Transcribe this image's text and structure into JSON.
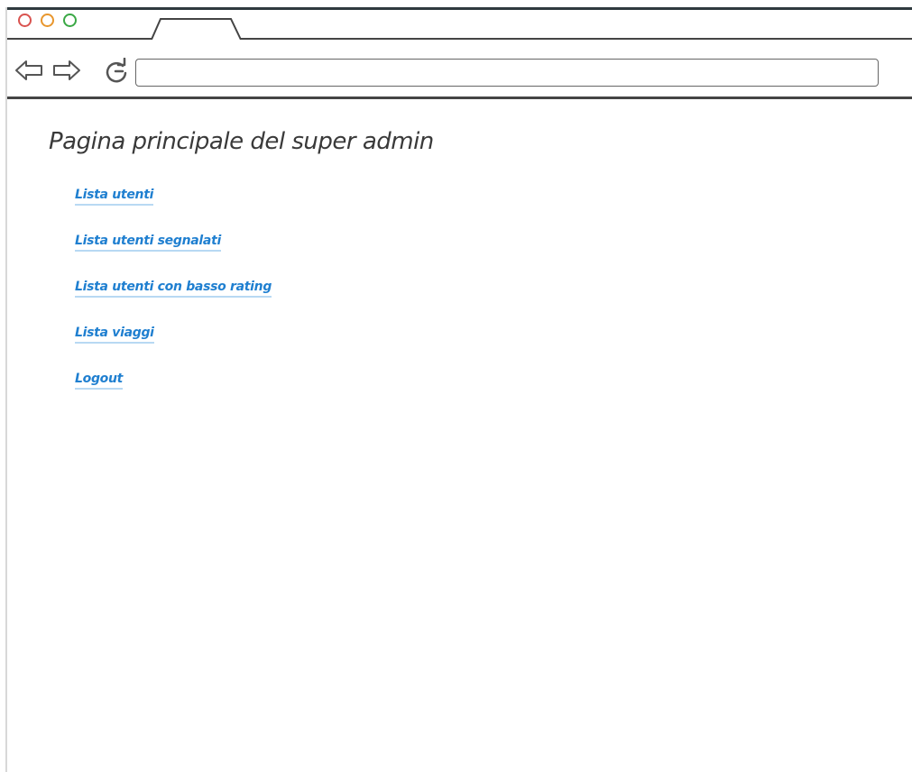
{
  "browser": {
    "tab_title": "",
    "address_value": ""
  },
  "page": {
    "title": "Pagina principale del super admin",
    "links": [
      {
        "label": "Lista utenti"
      },
      {
        "label": "Lista utenti segnalati"
      },
      {
        "label": "Lista utenti con basso rating"
      },
      {
        "label": "Lista viaggi"
      },
      {
        "label": "Logout"
      }
    ]
  },
  "colors": {
    "link": "#1f7fd0",
    "link_underline": "#b8d9f3",
    "title_text": "#3a3a3a",
    "close_button": "#d9534f",
    "minimize_button": "#e8962d",
    "maximize_button": "#3aa845"
  },
  "icons": {
    "back": "back-arrow-icon",
    "forward": "forward-arrow-icon",
    "reload": "reload-icon"
  }
}
